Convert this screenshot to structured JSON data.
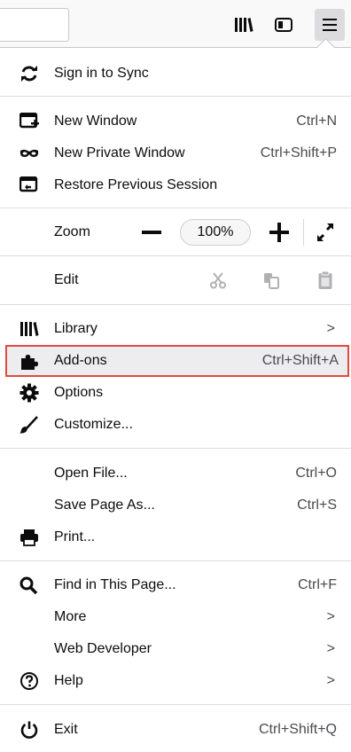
{
  "toolbar": {
    "url_field_value": "",
    "buttons": [
      {
        "name": "library",
        "icon": "library-icon"
      },
      {
        "name": "sidebars",
        "icon": "sidebar-icon"
      },
      {
        "name": "menu",
        "icon": "hamburger-menu-icon"
      }
    ]
  },
  "menu": {
    "sync": {
      "label": "Sign in to Sync",
      "icon": "sync-icon"
    },
    "new_window": {
      "label": "New Window",
      "shortcut": "Ctrl+N",
      "icon": "new-window-icon"
    },
    "new_private": {
      "label": "New Private Window",
      "shortcut": "Ctrl+Shift+P",
      "icon": "private-mask-icon"
    },
    "restore": {
      "label": "Restore Previous Session",
      "icon": "restore-session-icon"
    },
    "zoom": {
      "label": "Zoom",
      "value": "100%"
    },
    "edit": {
      "label": "Edit"
    },
    "library": {
      "label": "Library",
      "chevron": ">",
      "icon": "library-icon"
    },
    "addons": {
      "label": "Add-ons",
      "shortcut": "Ctrl+Shift+A",
      "icon": "puzzle-icon"
    },
    "options": {
      "label": "Options",
      "icon": "gear-icon"
    },
    "customize": {
      "label": "Customize...",
      "icon": "paintbrush-icon"
    },
    "open_file": {
      "label": "Open File...",
      "shortcut": "Ctrl+O"
    },
    "save_page": {
      "label": "Save Page As...",
      "shortcut": "Ctrl+S"
    },
    "print": {
      "label": "Print...",
      "icon": "printer-icon"
    },
    "find": {
      "label": "Find in This Page...",
      "shortcut": "Ctrl+F",
      "icon": "search-icon"
    },
    "more": {
      "label": "More",
      "chevron": ">"
    },
    "web_dev": {
      "label": "Web Developer",
      "chevron": ">"
    },
    "help": {
      "label": "Help",
      "chevron": ">",
      "icon": "help-icon"
    },
    "exit": {
      "label": "Exit",
      "shortcut": "Ctrl+Shift+Q",
      "icon": "power-icon"
    }
  },
  "colors": {
    "highlight_border": "#e04b3f",
    "highlight_bg": "#ededf0"
  }
}
